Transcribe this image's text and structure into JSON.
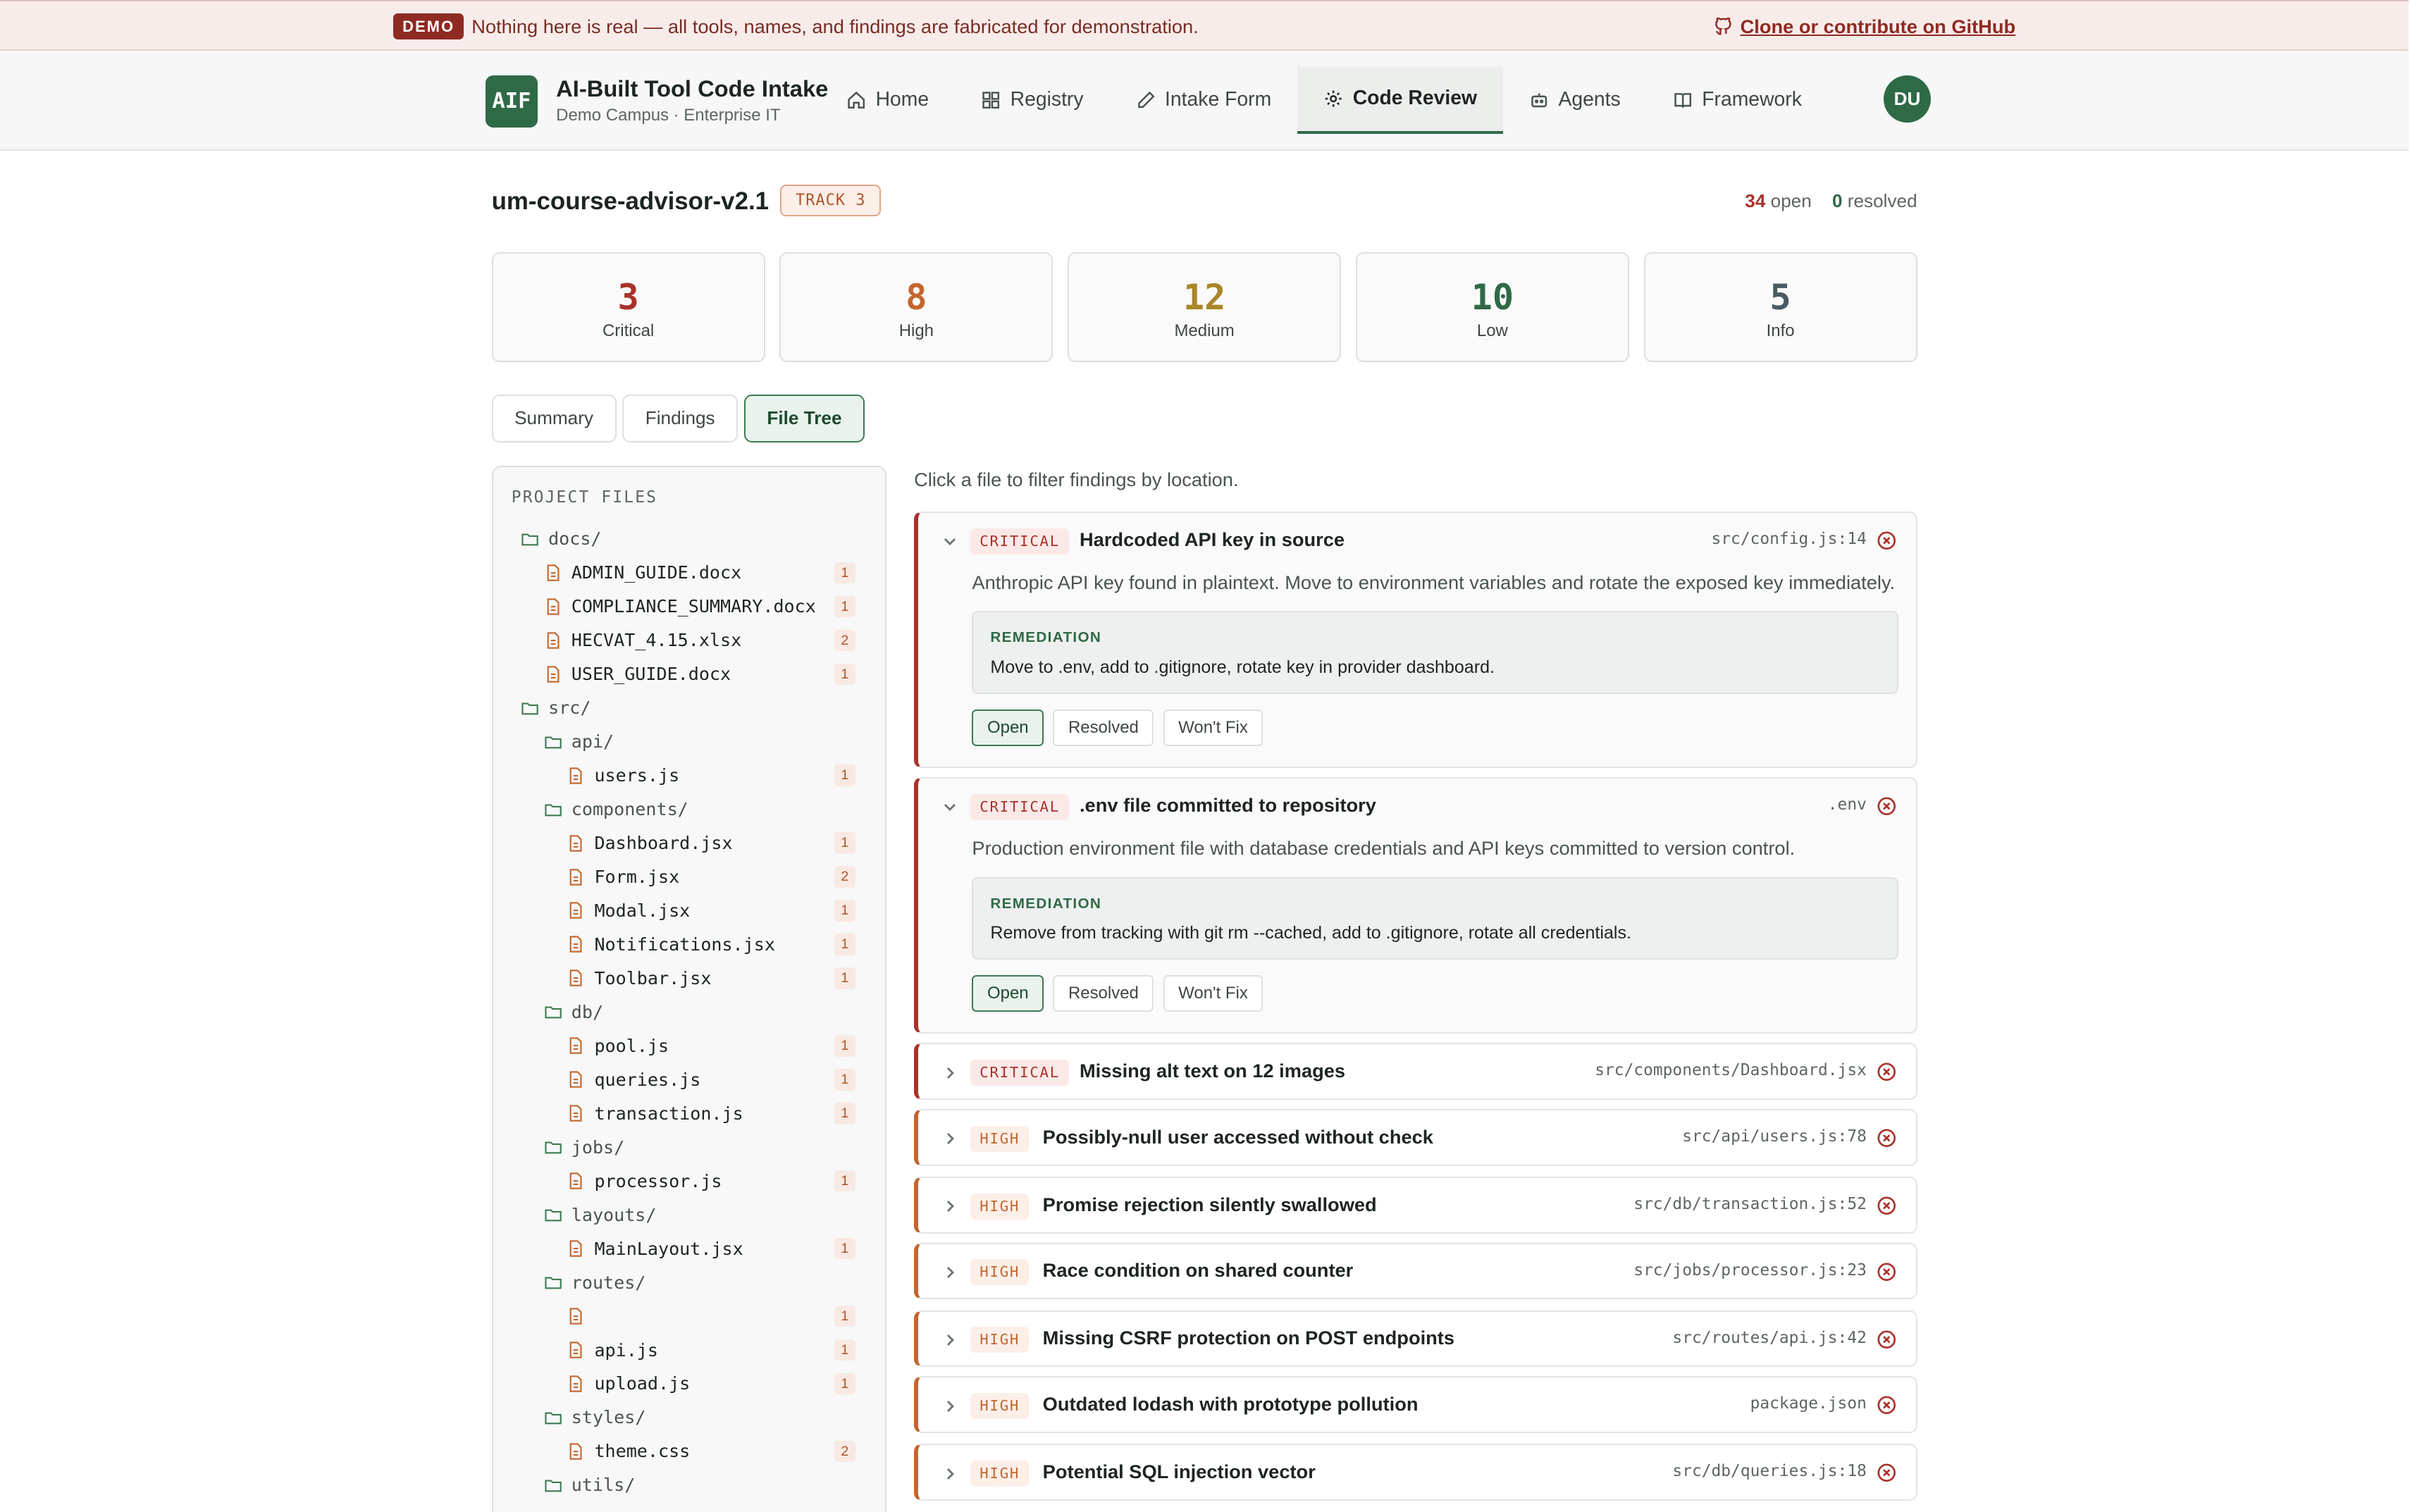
{
  "banner": {
    "badge": "DEMO",
    "message": "Nothing here is real — all tools, names, and findings are fabricated for demonstration.",
    "github_link": "Clone or contribute on GitHub"
  },
  "header": {
    "logo_text": "AIF",
    "app_title": "AI-Built Tool Code Intake",
    "app_subtitle": "Demo Campus · Enterprise IT",
    "nav": [
      "Home",
      "Registry",
      "Intake Form",
      "Code Review",
      "Agents",
      "Framework"
    ],
    "active_nav": "Code Review",
    "avatar": "DU"
  },
  "review": {
    "repo": "um-course-advisor-v2.1",
    "track": "TRACK 3",
    "open_count": "34",
    "open_label": "open",
    "resolved_count": "0",
    "resolved_label": "resolved"
  },
  "severity_cards": [
    {
      "value": "3",
      "label": "Critical",
      "color": "#a8322a"
    },
    {
      "value": "8",
      "label": "High",
      "color": "#c4662e"
    },
    {
      "value": "12",
      "label": "Medium",
      "color": "#a9862a"
    },
    {
      "value": "10",
      "label": "Low",
      "color": "#2f6a47"
    },
    {
      "value": "5",
      "label": "Info",
      "color": "#4a5a63"
    }
  ],
  "tabs": [
    "Summary",
    "Findings",
    "File Tree"
  ],
  "active_tab": "File Tree",
  "file_tree": {
    "heading": "PROJECT FILES",
    "rows": [
      {
        "name": "docs/",
        "type": "dir",
        "depth": 0
      },
      {
        "name": "ADMIN_GUIDE.docx",
        "type": "file",
        "depth": 1,
        "count": "1"
      },
      {
        "name": "COMPLIANCE_SUMMARY.docx",
        "type": "file",
        "depth": 1,
        "count": "1"
      },
      {
        "name": "HECVAT_4.15.xlsx",
        "type": "file",
        "depth": 1,
        "count": "2"
      },
      {
        "name": "USER_GUIDE.docx",
        "type": "file",
        "depth": 1,
        "count": "1"
      },
      {
        "name": "src/",
        "type": "dir",
        "depth": 0
      },
      {
        "name": "api/",
        "type": "dir",
        "depth": 1
      },
      {
        "name": "users.js",
        "type": "file",
        "depth": 2,
        "count": "1"
      },
      {
        "name": "components/",
        "type": "dir",
        "depth": 1
      },
      {
        "name": "Dashboard.jsx",
        "type": "file",
        "depth": 2,
        "count": "1"
      },
      {
        "name": "Form.jsx",
        "type": "file",
        "depth": 2,
        "count": "2"
      },
      {
        "name": "Modal.jsx",
        "type": "file",
        "depth": 2,
        "count": "1"
      },
      {
        "name": "Notifications.jsx",
        "type": "file",
        "depth": 2,
        "count": "1"
      },
      {
        "name": "Toolbar.jsx",
        "type": "file",
        "depth": 2,
        "count": "1"
      },
      {
        "name": "db/",
        "type": "dir",
        "depth": 1
      },
      {
        "name": "pool.js",
        "type": "file",
        "depth": 2,
        "count": "1"
      },
      {
        "name": "queries.js",
        "type": "file",
        "depth": 2,
        "count": "1"
      },
      {
        "name": "transaction.js",
        "type": "file",
        "depth": 2,
        "count": "1"
      },
      {
        "name": "jobs/",
        "type": "dir",
        "depth": 1
      },
      {
        "name": "processor.js",
        "type": "file",
        "depth": 2,
        "count": "1"
      },
      {
        "name": "layouts/",
        "type": "dir",
        "depth": 1
      },
      {
        "name": "MainLayout.jsx",
        "type": "file",
        "depth": 2,
        "count": "1"
      },
      {
        "name": "routes/",
        "type": "dir",
        "depth": 1
      },
      {
        "name": "",
        "type": "file",
        "depth": 2,
        "count": "1"
      },
      {
        "name": "api.js",
        "type": "file",
        "depth": 2,
        "count": "1"
      },
      {
        "name": "upload.js",
        "type": "file",
        "depth": 2,
        "count": "1"
      },
      {
        "name": "styles/",
        "type": "dir",
        "depth": 1
      },
      {
        "name": "theme.css",
        "type": "file",
        "depth": 2,
        "count": "2"
      },
      {
        "name": "utils/",
        "type": "dir",
        "depth": 1
      }
    ]
  },
  "findings_hint": "Click a file to filter findings by location.",
  "findings": [
    {
      "severity": "CRITICAL",
      "title": "Hardcoded API key in source",
      "location": "src/config.js:14",
      "expanded": true,
      "description": "Anthropic API key found in plaintext. Move to environment variables and rotate the exposed key immediately.",
      "remediation_label": "REMEDIATION",
      "remediation": "Move to .env, add to .gitignore, rotate key in provider dashboard.",
      "status_buttons": [
        "Open",
        "Resolved",
        "Won't Fix"
      ],
      "status": "Open"
    },
    {
      "severity": "CRITICAL",
      "title": ".env file committed to repository",
      "location": ".env",
      "expanded": true,
      "description": "Production environment file with database credentials and API keys committed to version control.",
      "remediation_label": "REMEDIATION",
      "remediation": "Remove from tracking with git rm --cached, add to .gitignore, rotate all credentials.",
      "status_buttons": [
        "Open",
        "Resolved",
        "Won't Fix"
      ],
      "status": "Open"
    },
    {
      "severity": "CRITICAL",
      "title": "Missing alt text on 12 images",
      "location": "src/components/Dashboard.jsx",
      "expanded": false
    },
    {
      "severity": "HIGH",
      "title": "Possibly-null user accessed without check",
      "location": "src/api/users.js:78",
      "expanded": false
    },
    {
      "severity": "HIGH",
      "title": "Promise rejection silently swallowed",
      "location": "src/db/transaction.js:52",
      "expanded": false
    },
    {
      "severity": "HIGH",
      "title": "Race condition on shared counter",
      "location": "src/jobs/processor.js:23",
      "expanded": false
    },
    {
      "severity": "HIGH",
      "title": "Missing CSRF protection on POST endpoints",
      "location": "src/routes/api.js:42",
      "expanded": false
    },
    {
      "severity": "HIGH",
      "title": "Outdated lodash with prototype pollution",
      "location": "package.json",
      "expanded": false
    },
    {
      "severity": "HIGH",
      "title": "Potential SQL injection vector",
      "location": "src/db/queries.js:18",
      "expanded": false
    }
  ]
}
